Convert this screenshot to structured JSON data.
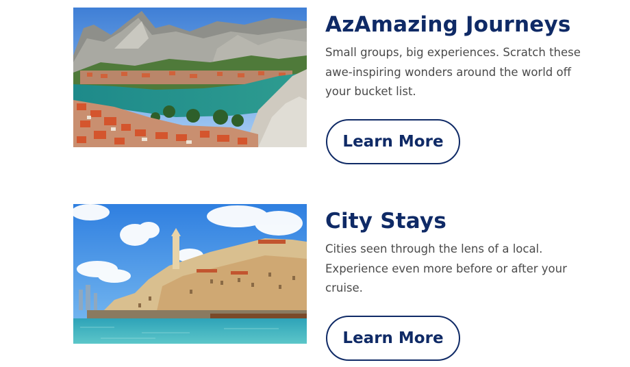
{
  "promos": [
    {
      "title": "AzAmazing Journeys",
      "description": "Small groups, big experiences. Scratch these awe-inspiring wonders around the world off your bucket list.",
      "button_label": "Learn More"
    },
    {
      "title": "City Stays",
      "description": "Cities seen through the lens of a local. Experience even more before or after your cruise.",
      "button_label": "Learn More"
    }
  ],
  "colors": {
    "heading": "#0f2a66",
    "body_text": "#4a4a4a",
    "button_border": "#0f2a66",
    "background": "#ffffff"
  }
}
